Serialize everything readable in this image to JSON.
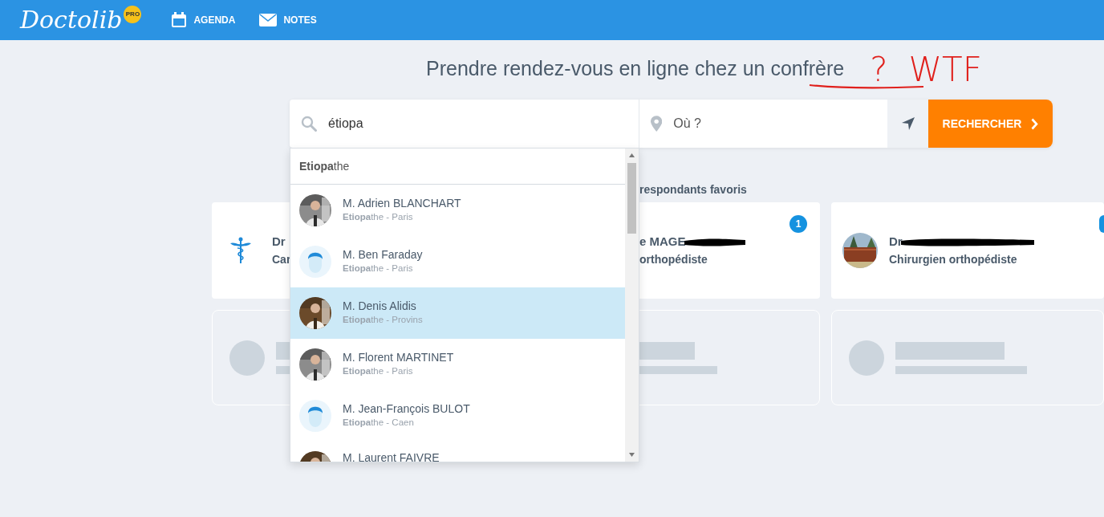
{
  "navbar": {
    "logo": "Doctolib",
    "logo_badge": "PRO",
    "links": [
      {
        "label": "AGENDA"
      },
      {
        "label": "NOTES"
      }
    ]
  },
  "heading": "Prendre rendez-vous en ligne chez un confrère",
  "annotations": [
    {
      "text": "?"
    },
    {
      "text": "WTF"
    }
  ],
  "search": {
    "query": "étiopa",
    "location_placeholder": "Où ?",
    "button": "RECHERCHER"
  },
  "dropdown": {
    "suggestion": "**Etiopa**the",
    "results": [
      {
        "name": "M. Adrien BLANCHART",
        "detail": "**Etiopa**the - Paris",
        "selected": false
      },
      {
        "name": "M. Ben Faraday",
        "detail": "**Etiopa**the - Paris",
        "kind": "default",
        "selected": false
      },
      {
        "name": "M. Denis Alidis",
        "detail": "**Etiopa**the - Provins",
        "selected": true
      },
      {
        "name": "M. Florent MARTINET",
        "detail": "**Etiopa**the - Paris",
        "selected": false
      },
      {
        "name": "M. Jean-François BULOT",
        "detail": "**Etiopa**the - Caen",
        "kind": "default",
        "selected": false
      },
      {
        "name": "M. Laurent FAIVRE",
        "selected": false
      }
    ]
  },
  "favorites_heading": "respondants favoris",
  "cards": [
    {
      "kind": "icon",
      "name": "Dr",
      "specialty": "Car",
      "redacted": false
    },
    {
      "kind": "covered",
      "name": "e MAGE",
      "specialty": "orthopédiste",
      "redacted": true,
      "badge": "1"
    },
    {
      "name": "Dr",
      "specialty": "Chirurgien orthopédiste",
      "redacted": true,
      "badge_partial": true
    },
    {
      "kind": "placeholder"
    },
    {
      "kind": "placeholder"
    },
    {
      "kind": "placeholder"
    }
  ]
}
